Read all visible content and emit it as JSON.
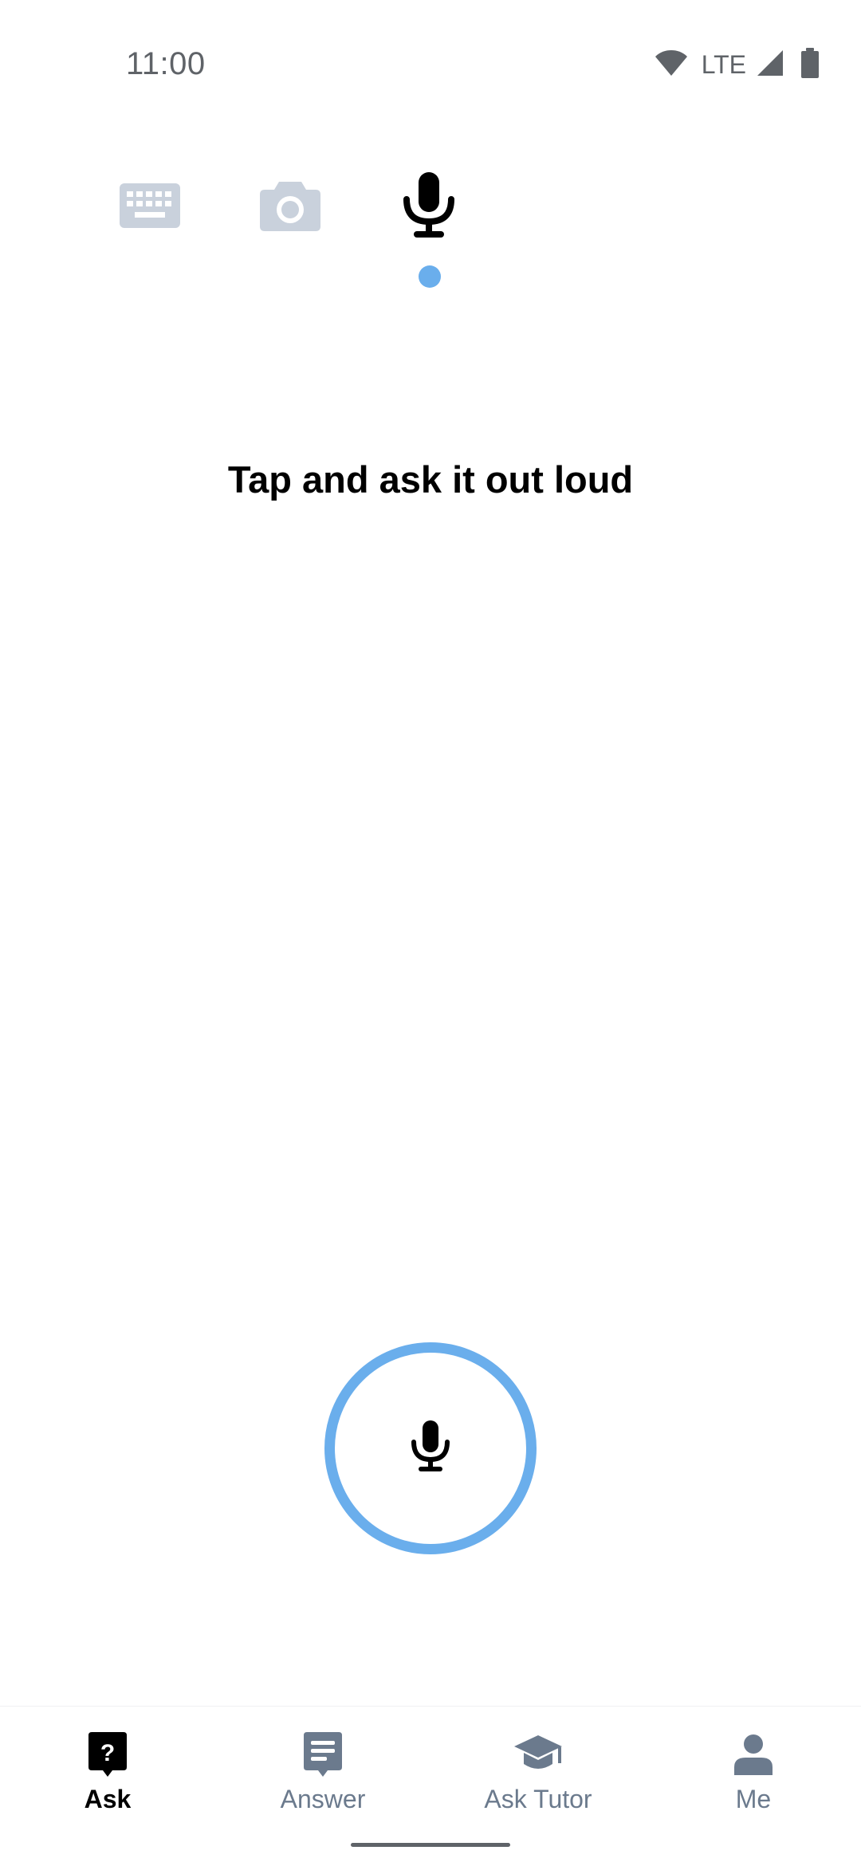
{
  "status_bar": {
    "time": "11:00",
    "network": "LTE",
    "icons": [
      "wifi-icon",
      "cell-signal-icon",
      "battery-icon"
    ]
  },
  "mode_tabs": [
    {
      "name": "keyboard",
      "icon": "keyboard-icon",
      "active": false
    },
    {
      "name": "camera",
      "icon": "camera-icon",
      "active": false
    },
    {
      "name": "voice",
      "icon": "microphone-icon",
      "active": true
    }
  ],
  "main": {
    "prompt": "Tap and ask it out loud"
  },
  "bottom_nav": {
    "items": [
      {
        "label": "Ask",
        "icon": "question-bubble-icon",
        "active": true
      },
      {
        "label": "Answer",
        "icon": "answer-bubble-icon",
        "active": false
      },
      {
        "label": "Ask Tutor",
        "icon": "graduation-cap-icon",
        "active": false
      },
      {
        "label": "Me",
        "icon": "person-icon",
        "active": false
      }
    ]
  },
  "colors": {
    "accent": "#6aaeec",
    "inactive_icon": "#c9d1dc",
    "nav_inactive": "#6b7a8d",
    "status_gray": "#5f6368"
  }
}
